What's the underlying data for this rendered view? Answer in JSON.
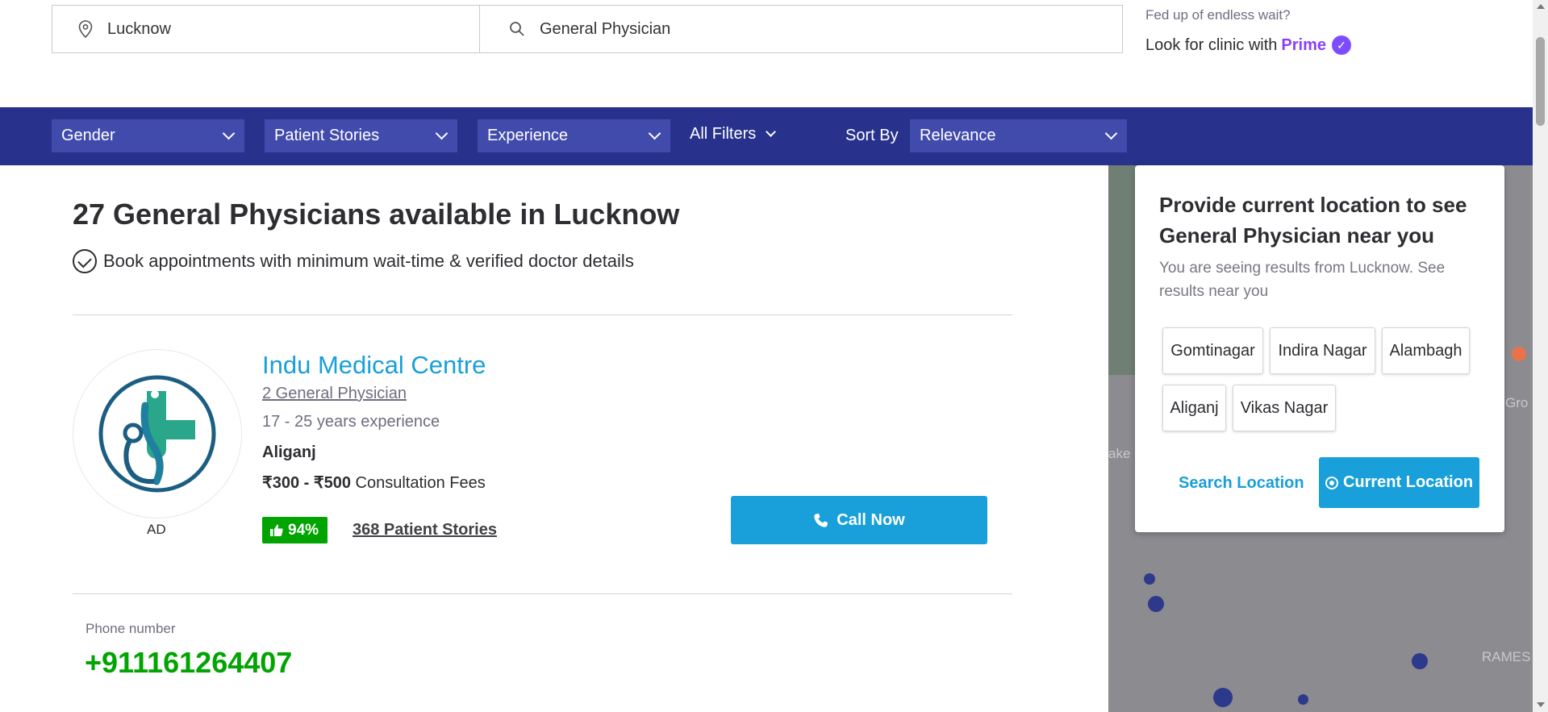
{
  "search": {
    "location_value": "Lucknow",
    "specialty_value": "General Physician"
  },
  "wait_promo": {
    "question": "Fed up of endless wait?",
    "cta_text": "Look for clinic with",
    "prime_label": "Prime"
  },
  "filters": {
    "gender_label": "Gender",
    "patient_stories_label": "Patient Stories",
    "experience_label": "Experience",
    "all_filters_label": "All Filters",
    "sort_by_label": "Sort By",
    "sort_value": "Relevance"
  },
  "results": {
    "heading": "27 General Physicians available in Lucknow",
    "subline": "Book appointments with minimum wait-time & verified doctor details"
  },
  "clinic": {
    "name": "Indu Medical Centre",
    "doctor_count": "2 General Physician",
    "experience": "17 - 25 years experience",
    "locality": "Aliganj",
    "fee_amount": "₹300 - ₹500",
    "fee_label": "Consultation Fees",
    "rating": "94%",
    "stories": "368 Patient Stories",
    "ad_tag": "AD",
    "call_label": "Call Now",
    "logo_colors": {
      "ring": "#1b5e82",
      "cross": "#2aa68a",
      "teal": "#1f7f9f"
    }
  },
  "contact": {
    "phone_label": "Phone number",
    "phone_number": "+911161264407"
  },
  "location_popup": {
    "title": "Provide current location to see General Physician near you",
    "subtitle": "You are seeing results from Lucknow. See results near you",
    "localities": [
      "Gomtinagar",
      "Indira Nagar",
      "Alambagh",
      "Aliganj",
      "Vikas Nagar"
    ],
    "search_location_label": "Search Location",
    "current_location_label": "Current Location"
  },
  "map": {
    "label_left": "ake",
    "label_right": "Gro",
    "label_bottom": "RAMES"
  },
  "colors": {
    "brand_navy": "#28328c",
    "accent_blue": "#199fd9",
    "green": "#01a400",
    "prime_purple": "#8a3ffc"
  }
}
